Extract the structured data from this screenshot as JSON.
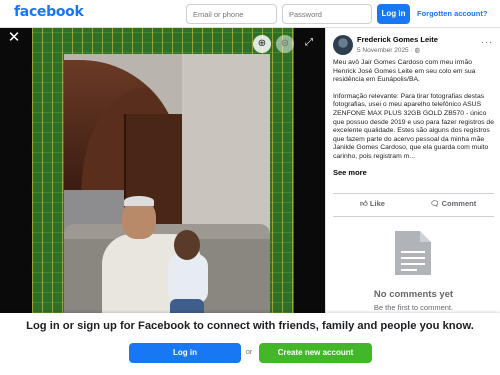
{
  "header": {
    "logo": "facebook",
    "email_placeholder": "Email or phone",
    "password_placeholder": "Password",
    "login_label": "Log in",
    "forgot_label": "Forgotten account?"
  },
  "viewer": {
    "close_icon": "close-icon",
    "zoom_in_icon": "zoom-in-icon",
    "zoom_out_icon": "zoom-out-icon",
    "expand_icon": "expand-icon"
  },
  "post": {
    "author": "Frederick Gomes Leite",
    "date": "5 November 2025",
    "privacy_icon": "globe-icon",
    "paragraph1": "Meu avô Jair Gomes Cardoso com meu irmão Henrick José Gomes Leite em seu colo em sua residência em Eunápolis/BA.",
    "paragraph2": "Informação relevante: Para tirar fotografias destas fotografias, usei o meu aparelho telefônico ASUS ZENFONE MAX PLUS 32GB GOLD ZB570 - único que possuo desde 2019 e uso para fazer registros de excelente qualidade. Estes são alguns dos registros que fazem parte do acervo pessoal da minha mãe Janilde Gomes Cardoso, que ela guarda com muito carinho, pois registram m...",
    "see_more": "See more",
    "like_label": "Like",
    "comment_label": "Comment",
    "no_comments": "No comments yet",
    "first_comment": "Be the first to comment."
  },
  "footer": {
    "cta": "Log in or sign up for Facebook to connect with friends, family and people you know.",
    "login_label": "Log in",
    "or_label": "or",
    "create_label": "Create new account"
  },
  "colors": {
    "brand": "#1877f2",
    "create": "#42b72a"
  }
}
